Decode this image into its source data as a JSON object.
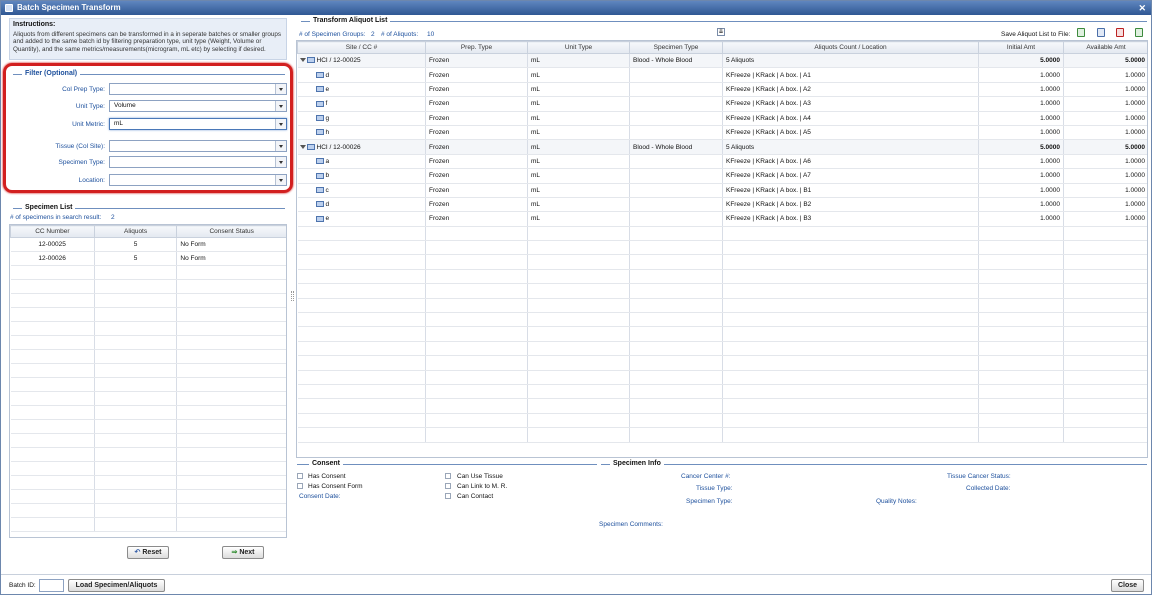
{
  "window": {
    "title": "Batch Specimen Transform",
    "close_glyph": "✕"
  },
  "instructions": {
    "heading": "Instructions:",
    "text": "Aliquots from different specimens can be transformed in a in seperate batches or smaller groups and added to the same batch id by filtering preparation type, unit type (Weight, Volume or Quantity), and the same metrics/measurements(microgram, mL etc) by selecting if desired."
  },
  "filter": {
    "title": "Filter (Optional)",
    "col_prep_type": {
      "label": "Col Prep Type:",
      "value": ""
    },
    "unit_type": {
      "label": "Unit Type:",
      "value": "Volume"
    },
    "unit_metric": {
      "label": "Unit Metric:",
      "value": "mL"
    },
    "tissue": {
      "label": "Tissue (Col Site):",
      "value": ""
    },
    "specimen_type": {
      "label": "Specimen Type:",
      "value": ""
    },
    "location": {
      "label": "Location:",
      "value": ""
    }
  },
  "specimen_list": {
    "title": "Specimen List",
    "count_label": "# of specimens in search result:",
    "count": "2",
    "columns": [
      "CC Number",
      "Aliquots",
      "Consent Status"
    ],
    "rows": [
      [
        "12-00025",
        "5",
        "No Form"
      ],
      [
        "12-00026",
        "5",
        "No Form"
      ]
    ]
  },
  "buttons": {
    "reset": "Reset",
    "next": "Next",
    "load": "Load Specimen/Aliquots",
    "close": "Close",
    "reset_icon": "↶",
    "next_icon": "⇒"
  },
  "batch": {
    "label": "Batch ID:",
    "value": ""
  },
  "transform": {
    "title": "Transform Aliquot List",
    "groups_label": "# of Specimen Groups:",
    "groups": "2",
    "aliquots_label": "# of Aliquots:",
    "aliquots": "10",
    "save_label": "Save Aliquot List to File:",
    "collapse_glyph": "⇊",
    "save_icons": [
      "excel-export-icon",
      "csv-export-icon",
      "pdf-export-icon",
      "xml-export-icon"
    ],
    "columns": [
      "Site / CC #",
      "Prep. Type",
      "Unit Type",
      "Specimen Type",
      "Aliquots Count / Location",
      "Initial Amt",
      "Available Amt"
    ],
    "rows": [
      {
        "group": true,
        "site": "HCI / 12-00025",
        "prep": "Frozen",
        "unit": "mL",
        "spec": "Blood - Whole Blood",
        "loc": "5 Aliquots",
        "init": "5.0000",
        "avail": "5.0000"
      },
      {
        "group": false,
        "site": "d",
        "prep": "Frozen",
        "unit": "mL",
        "spec": "",
        "loc": "KFreeze | KRack | A box. | A1",
        "init": "1.0000",
        "avail": "1.0000"
      },
      {
        "group": false,
        "site": "e",
        "prep": "Frozen",
        "unit": "mL",
        "spec": "",
        "loc": "KFreeze | KRack | A box. | A2",
        "init": "1.0000",
        "avail": "1.0000"
      },
      {
        "group": false,
        "site": "f",
        "prep": "Frozen",
        "unit": "mL",
        "spec": "",
        "loc": "KFreeze | KRack | A box. | A3",
        "init": "1.0000",
        "avail": "1.0000"
      },
      {
        "group": false,
        "site": "g",
        "prep": "Frozen",
        "unit": "mL",
        "spec": "",
        "loc": "KFreeze | KRack | A box. | A4",
        "init": "1.0000",
        "avail": "1.0000"
      },
      {
        "group": false,
        "site": "h",
        "prep": "Frozen",
        "unit": "mL",
        "spec": "",
        "loc": "KFreeze | KRack | A box. | A5",
        "init": "1.0000",
        "avail": "1.0000"
      },
      {
        "group": true,
        "site": "HCI / 12-00026",
        "prep": "Frozen",
        "unit": "mL",
        "spec": "Blood - Whole Blood",
        "loc": "5 Aliquots",
        "init": "5.0000",
        "avail": "5.0000"
      },
      {
        "group": false,
        "site": "a",
        "prep": "Frozen",
        "unit": "mL",
        "spec": "",
        "loc": "KFreeze | KRack | A box. | A6",
        "init": "1.0000",
        "avail": "1.0000"
      },
      {
        "group": false,
        "site": "b",
        "prep": "Frozen",
        "unit": "mL",
        "spec": "",
        "loc": "KFreeze | KRack | A box. | A7",
        "init": "1.0000",
        "avail": "1.0000"
      },
      {
        "group": false,
        "site": "c",
        "prep": "Frozen",
        "unit": "mL",
        "spec": "",
        "loc": "KFreeze | KRack | A box. | B1",
        "init": "1.0000",
        "avail": "1.0000"
      },
      {
        "group": false,
        "site": "d",
        "prep": "Frozen",
        "unit": "mL",
        "spec": "",
        "loc": "KFreeze | KRack | A box. | B2",
        "init": "1.0000",
        "avail": "1.0000"
      },
      {
        "group": false,
        "site": "e",
        "prep": "Frozen",
        "unit": "mL",
        "spec": "",
        "loc": "KFreeze | KRack | A box. | B3",
        "init": "1.0000",
        "avail": "1.0000"
      }
    ]
  },
  "consent": {
    "title": "Consent",
    "has_consent": "Has Consent",
    "has_consent_form": "Has Consent Form",
    "consent_date": "Consent Date:",
    "can_use_tissue": "Can Use Tissue",
    "can_link": "Can Link to M. R.",
    "can_contact": "Can Contact"
  },
  "specimen_info": {
    "title": "Specimen Info",
    "cancer_center": "Cancer Center #:",
    "tissue_type": "Tissue Type:",
    "specimen_type": "Specimen Type:",
    "tissue_cancer_status": "Tissue Cancer Status:",
    "collected_date": "Collected Date:",
    "quality_notes": "Quality Notes:",
    "specimen_comments": "Specimen Comments:"
  },
  "colors": {
    "title_bar": "#3a62a0",
    "label_blue": "#1c4f9c",
    "highlight": "#d21f1f"
  }
}
